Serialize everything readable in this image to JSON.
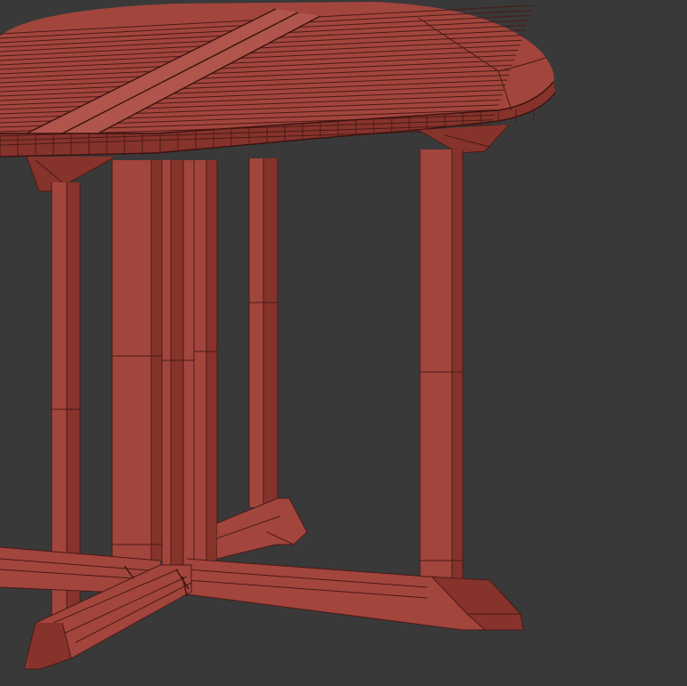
{
  "scene": {
    "background_color": "#393939",
    "wood_color": "#a2453d",
    "wood_shadow_color": "#86332c",
    "wireframe_color": "#4a1a16"
  }
}
